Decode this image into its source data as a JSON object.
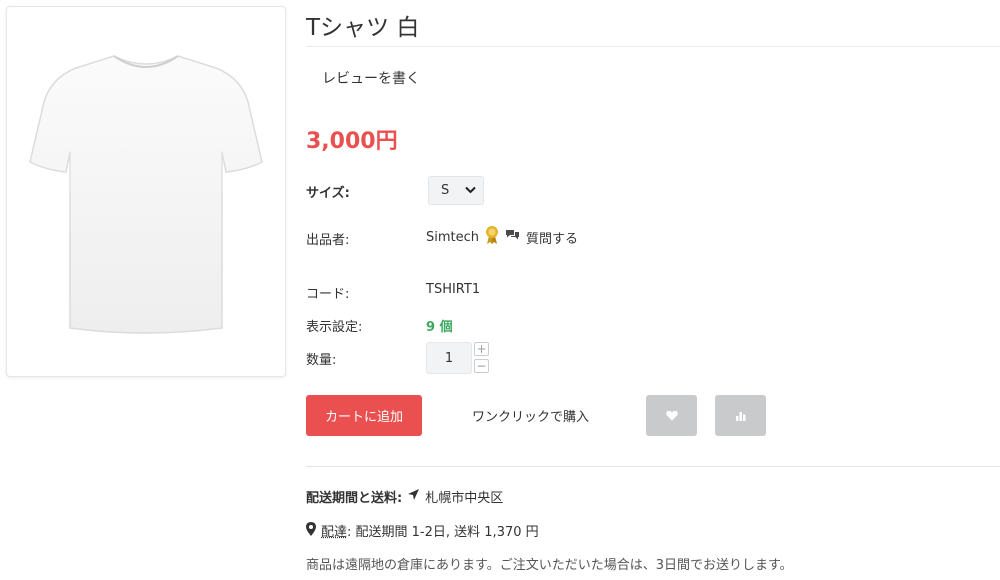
{
  "product": {
    "title": "Tシャツ 白",
    "review_link": "レビューを書く",
    "price": "3,000円"
  },
  "options": {
    "size_label": "サイズ:",
    "size_value": "S"
  },
  "vendor": {
    "label": "出品者:",
    "name": "Simtech",
    "ask_label": "質問する"
  },
  "details": {
    "code_label": "コード:",
    "code_value": "TSHIRT1",
    "stock_label": "表示設定:",
    "stock_value": "9 個",
    "qty_label": "数量:",
    "qty_value": "1",
    "qty_plus": "+",
    "qty_minus": "−"
  },
  "actions": {
    "add_to_cart": "カートに追加",
    "one_click": "ワンクリックで購入"
  },
  "shipping": {
    "label": "配送期間と送料:",
    "city": "札幌市中央区",
    "delivery_term": "配達",
    "delivery_detail": ": 配送期間 1-2日, 送料 1,370 円",
    "note": "商品は遠隔地の倉庫にあります。ご注文いただいた場合は、3日間でお送りします。"
  },
  "colors": {
    "accent": "#e9504f",
    "stock": "#3da85d",
    "icon_button": "#c9cacc"
  },
  "icons": [
    "chevron-down-icon",
    "award-icon",
    "chat-icon",
    "heart-icon",
    "bar-chart-icon",
    "location-arrow-icon",
    "map-pin-icon"
  ]
}
